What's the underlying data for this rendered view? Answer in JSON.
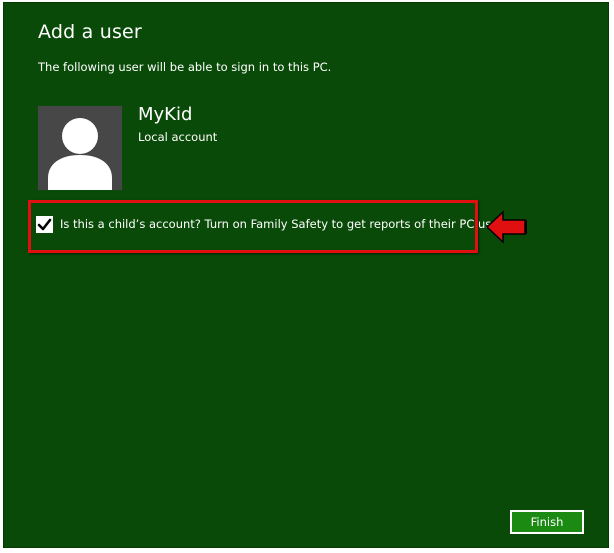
{
  "dialog": {
    "title": "Add a user",
    "subtitle": "The following user will be able to sign in to this PC."
  },
  "user": {
    "name": "MyKid",
    "account_type": "Local account",
    "avatar_icon": "person-silhouette-icon"
  },
  "family_safety": {
    "checked": true,
    "label": "Is this a child’s account? Turn on Family Safety to get reports of their PC use."
  },
  "annotation": {
    "highlight_color": "#e01010",
    "arrow_icon": "red-arrow-left-icon"
  },
  "footer": {
    "finish_label": "Finish"
  },
  "colors": {
    "background": "#0a4a08",
    "button": "#1a8a12",
    "avatar_bg": "#474747"
  }
}
